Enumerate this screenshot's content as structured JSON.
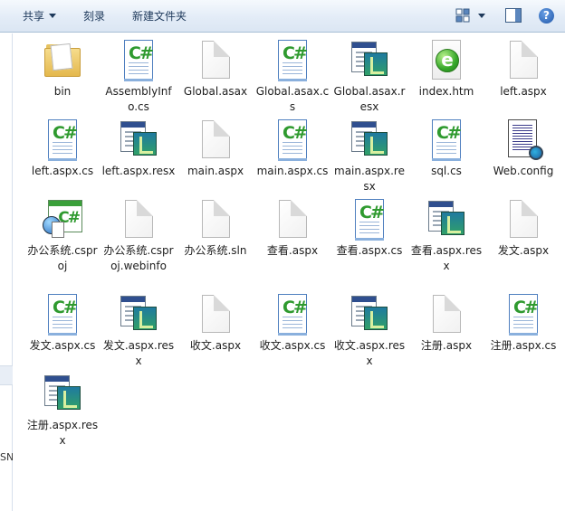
{
  "toolbar": {
    "share_label": "共享",
    "burn_label": "刻录",
    "new_folder_label": "新建文件夹"
  },
  "navpane": {
    "partial_text": "SN"
  },
  "files": [
    {
      "name": "bin",
      "label": "bin",
      "type": "folder"
    },
    {
      "name": "AssemblyInfo.cs",
      "label": "AssemblyInfo.cs",
      "type": "cs"
    },
    {
      "name": "Global.asax",
      "label": "Global.asax",
      "type": "blank"
    },
    {
      "name": "Global.asax.cs",
      "label": "Global.asax.cs",
      "type": "cs"
    },
    {
      "name": "Global.asax.resx",
      "label": "Global.asax.resx",
      "type": "resx"
    },
    {
      "name": "index.htm",
      "label": "index.htm",
      "type": "htm"
    },
    {
      "name": "left.aspx",
      "label": "left.aspx",
      "type": "blank"
    },
    {
      "name": "left.aspx.cs",
      "label": "left.aspx.cs",
      "type": "cs"
    },
    {
      "name": "left.aspx.resx",
      "label": "left.aspx.resx",
      "type": "resx"
    },
    {
      "name": "main.aspx",
      "label": "main.aspx",
      "type": "blank"
    },
    {
      "name": "main.aspx.cs",
      "label": "main.aspx.cs",
      "type": "cs"
    },
    {
      "name": "main.aspx.resx",
      "label": "main.aspx.resx",
      "type": "resx"
    },
    {
      "name": "sql.cs",
      "label": "sql.cs",
      "type": "cs"
    },
    {
      "name": "Web.config",
      "label": "Web.config",
      "type": "config"
    },
    {
      "name": "办公系统.csproj",
      "label": "办公系统.csproj",
      "type": "csproj"
    },
    {
      "name": "办公系统.csproj.webinfo",
      "label": "办公系统.csproj.webinfo",
      "type": "blank"
    },
    {
      "name": "办公系统.sln",
      "label": "办公系统.sln",
      "type": "blank"
    },
    {
      "name": "查看.aspx",
      "label": "查看.aspx",
      "type": "blank"
    },
    {
      "name": "查看.aspx.cs",
      "label": "查看.aspx.cs",
      "type": "cs"
    },
    {
      "name": "查看.aspx.resx",
      "label": "查看.aspx.resx",
      "type": "resx"
    },
    {
      "name": "发文.aspx",
      "label": "发文.aspx",
      "type": "blank"
    },
    {
      "name": "发文.aspx.cs",
      "label": "发文.aspx.cs",
      "type": "cs"
    },
    {
      "name": "发文.aspx.resx",
      "label": "发文.aspx.resx",
      "type": "resx"
    },
    {
      "name": "收文.aspx",
      "label": "收文.aspx",
      "type": "blank"
    },
    {
      "name": "收文.aspx.cs",
      "label": "收文.aspx.cs",
      "type": "cs"
    },
    {
      "name": "收文.aspx.resx",
      "label": "收文.aspx.resx",
      "type": "resx"
    },
    {
      "name": "注册.aspx",
      "label": "注册.aspx",
      "type": "blank"
    },
    {
      "name": "注册.aspx.cs",
      "label": "注册.aspx.cs",
      "type": "cs"
    },
    {
      "name": "注册.aspx.resx",
      "label": "注册.aspx.resx",
      "type": "resx"
    }
  ]
}
